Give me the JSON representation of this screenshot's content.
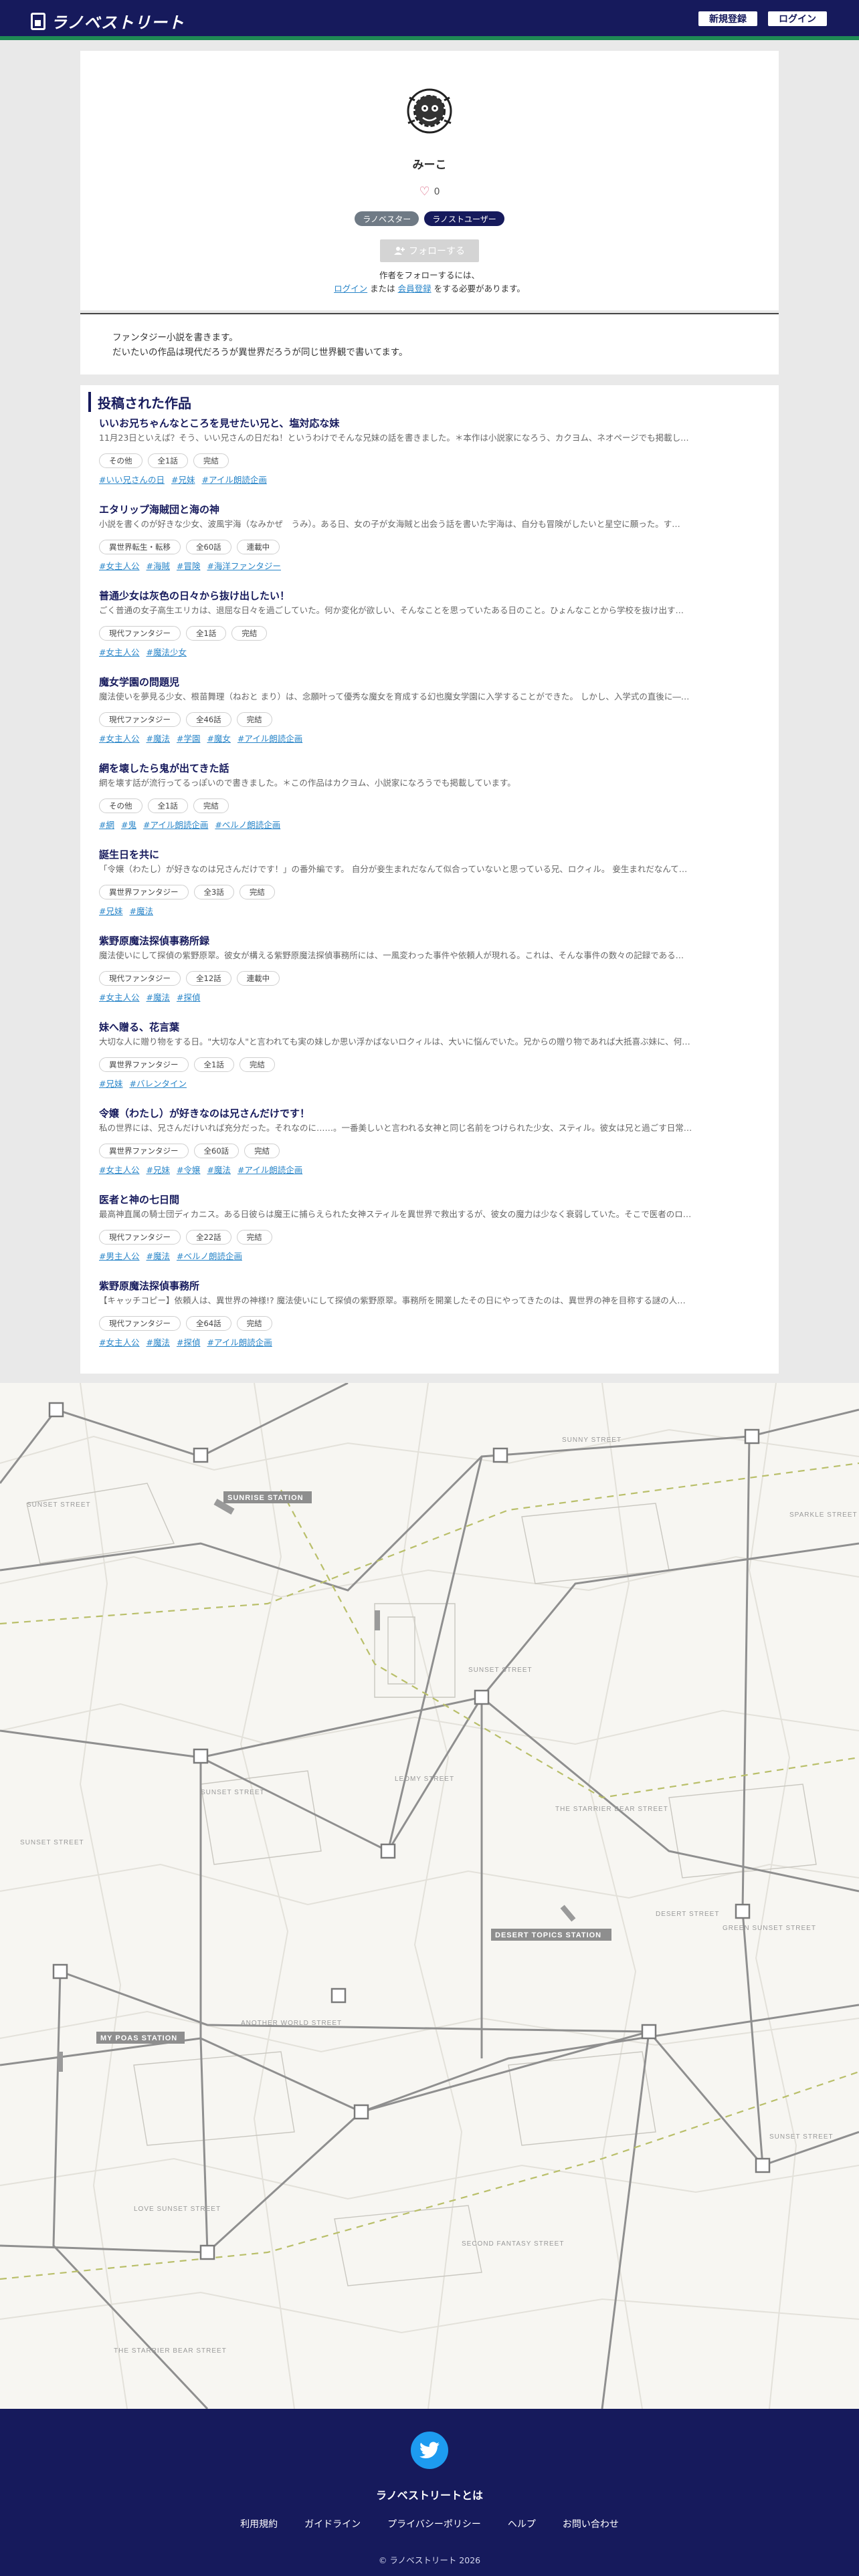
{
  "header": {
    "logo_text": "ラノベストリート",
    "register_label": "新規登録",
    "login_label": "ログイン"
  },
  "profile": {
    "username": "みーこ",
    "like_count": "0",
    "badges": [
      "ラノベスター",
      "ラノストユーザー"
    ],
    "follow_label": "フォローする",
    "follow_note_line1": "作者をフォローするには、",
    "follow_note_login": "ログイン",
    "follow_note_or": " または ",
    "follow_note_register": "会員登録",
    "follow_note_tail": " をする必要があります。"
  },
  "bio": {
    "line1": "ファンタジー小説を書きます。",
    "line2": "だいたいの作品は現代だろうが異世界だろうが同じ世界観で書いてます。"
  },
  "works_section": {
    "title": "投稿された作品",
    "works": [
      {
        "title": "いいお兄ちゃんなところを見せたい兄と、塩対応な妹",
        "desc": "11月23日といえば？そう、いい兄さんの日だね！というわけでそんな兄妹の話を書きました。＊本作は小説家になろう、カクヨム、ネオページでも掲載し…",
        "meta": [
          "その他",
          "全1話",
          "完結"
        ],
        "tags": [
          "#いい兄さんの日",
          "#兄妹",
          "#アイル朗読企画"
        ]
      },
      {
        "title": "エタリップ海賊団と海の神",
        "desc": "小説を書くのが好きな少女、波風宇海（なみかぜ　うみ）。ある日、女の子が女海賊と出会う話を書いた宇海は、自分も冒険がしたいと星空に願った。す…",
        "meta": [
          "異世界転生・転移",
          "全60話",
          "連載中"
        ],
        "tags": [
          "#女主人公",
          "#海賊",
          "#冒険",
          "#海洋ファンタジー"
        ]
      },
      {
        "title": "普通少女は灰色の日々から抜け出したい！",
        "desc": "ごく普通の女子高生エリカは、退屈な日々を過ごしていた。何か変化が欲しい、そんなことを思っていたある日のこと。ひょんなことから学校を抜け出す…",
        "meta": [
          "現代ファンタジー",
          "全1話",
          "完結"
        ],
        "tags": [
          "#女主人公",
          "#魔法少女"
        ]
      },
      {
        "title": "魔女学園の問題児",
        "desc": "魔法使いを夢見る少女、根苗舞理（ねおと まり）は、念願叶って優秀な魔女を育成する幻也魔女学園に入学することができた。 しかし、入学式の直後に―…",
        "meta": [
          "現代ファンタジー",
          "全46話",
          "完結"
        ],
        "tags": [
          "#女主人公",
          "#魔法",
          "#学園",
          "#魔女",
          "#アイル朗読企画"
        ]
      },
      {
        "title": "網を壊したら鬼が出てきた話",
        "desc": "網を壊す話が流行ってるっぽいので書きました。＊この作品はカクヨム、小説家になろうでも掲載しています。",
        "meta": [
          "その他",
          "全1話",
          "完結"
        ],
        "tags": [
          "#網",
          "#鬼",
          "#アイル朗読企画",
          "#ベルノ朗読企画"
        ]
      },
      {
        "title": "誕生日を共に",
        "desc": "「令嬢（わたし）が好きなのは兄さんだけです！」の番外編です。 自分が妾生まれだなんて似合っていないと思っている兄、ロクィル。 妾生まれだなんて…",
        "meta": [
          "異世界ファンタジー",
          "全3話",
          "完結"
        ],
        "tags": [
          "#兄妹",
          "#魔法"
        ]
      },
      {
        "title": "紫野原魔法探偵事務所録",
        "desc": "魔法使いにして探偵の紫野原翠。彼女が構える紫野原魔法探偵事務所には、一風変わった事件や依頼人が現れる。これは、そんな事件の数々の記録である…",
        "meta": [
          "現代ファンタジー",
          "全12話",
          "連載中"
        ],
        "tags": [
          "#女主人公",
          "#魔法",
          "#探偵"
        ]
      },
      {
        "title": "妹へ贈る、花言葉",
        "desc": "大切な人に贈り物をする日。\"大切な人\"と言われても実の妹しか思い浮かばないロクィルは、大いに悩んでいた。兄からの贈り物であれば大抵喜ぶ妹に、何…",
        "meta": [
          "異世界ファンタジー",
          "全1話",
          "完結"
        ],
        "tags": [
          "#兄妹",
          "#バレンタイン"
        ]
      },
      {
        "title": "令嬢（わたし）が好きなのは兄さんだけです！",
        "desc": "私の世界には、兄さんだけいれば充分だった。それなのに……。一番美しいと言われる女神と同じ名前をつけられた少女、スティル。彼女は兄と過ごす日常…",
        "meta": [
          "異世界ファンタジー",
          "全60話",
          "完結"
        ],
        "tags": [
          "#女主人公",
          "#兄妹",
          "#令嬢",
          "#魔法",
          "#アイル朗読企画"
        ]
      },
      {
        "title": "医者と神の七日間",
        "desc": "最高神直属の騎士団ディカニス。ある日彼らは魔王に捕らえられた女神スティルを異世界で救出するが、彼女の魔力は少なく衰弱していた。そこで医者のロ…",
        "meta": [
          "現代ファンタジー",
          "全22話",
          "完結"
        ],
        "tags": [
          "#男主人公",
          "#魔法",
          "#ベルノ朗読企画"
        ]
      },
      {
        "title": "紫野原魔法探偵事務所",
        "desc": "【キャッチコピー】依頼人は、異世界の神様!? 魔法使いにして探偵の紫野原翠。事務所を開業したその日にやってきたのは、異世界の神を目称する謎の人…",
        "meta": [
          "現代ファンタジー",
          "全64話",
          "完結"
        ],
        "tags": [
          "#女主人公",
          "#魔法",
          "#探偵",
          "#アイル朗読企画"
        ]
      }
    ]
  },
  "map": {
    "stations": [
      "SUNRISE STATION",
      "MY POAS STATION",
      "DESERT TOPICS STATION"
    ],
    "streets": [
      "SUNSET STREET",
      "SUNNY STREET",
      "SPARKLE STREET",
      "SUNSET STREET",
      "SUNSET STREET",
      "LEOMY STREET",
      "THE STARRIER BEAR STREET",
      "SUNSET STREET",
      "GREEN SUNSET STREET",
      "DESERT STREET",
      "LOVE SUNSET STREET",
      "SECOND FANTASY STREET",
      "THE STARRIER BEAR STREET",
      "ANOTHER WORLD STREET",
      "SUNSET STREET"
    ]
  },
  "footer": {
    "about": "ラノベストリートとは",
    "links": [
      "利用規約",
      "ガイドライン",
      "プライバシーポリシー",
      "ヘルプ",
      "お問い合わせ"
    ],
    "copyright": "© ラノベストリート 2026"
  },
  "colors": {
    "navy": "#161a5c",
    "green_accent": "#1f8a55",
    "link": "#2a86c9",
    "twitter": "#1d9bf0"
  }
}
